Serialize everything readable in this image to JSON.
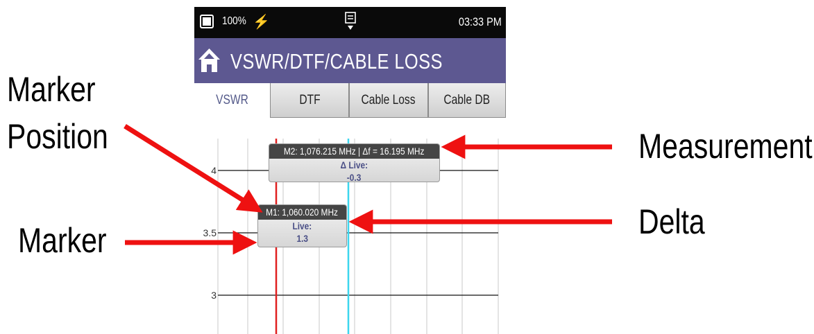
{
  "callouts": {
    "marker_position_line1": "Marker",
    "marker_position_line2": "Position",
    "marker": "Marker",
    "measurement": "Measurement",
    "delta": "Delta"
  },
  "status_bar": {
    "battery": "100%",
    "time": "03:33 PM"
  },
  "title_bar": {
    "title": "VSWR/DTF/CABLE LOSS",
    "home_icon": "home-icon"
  },
  "tabs": [
    {
      "label": "VSWR",
      "active": true
    },
    {
      "label": "DTF",
      "active": false
    },
    {
      "label": "Cable Loss",
      "active": false
    },
    {
      "label": "Cable DB",
      "active": false
    }
  ],
  "chart": {
    "y_ticks": [
      "4",
      "3.5",
      "3"
    ]
  },
  "markers": {
    "m2": {
      "header": "M2: 1,076.215 MHz  |  Δf = 16.195 MHz",
      "label": "Δ Live:",
      "value": "-0.3"
    },
    "m1": {
      "header": "M1: 1,060.020 MHz",
      "label": "Live:",
      "value": "1.3"
    }
  },
  "colors": {
    "title_bar": "#5d5891",
    "status_bar": "#0a0a0a",
    "arrow": "#ee1111",
    "marker1_line": "#e02020",
    "marker2_line": "#3cd6ee"
  }
}
